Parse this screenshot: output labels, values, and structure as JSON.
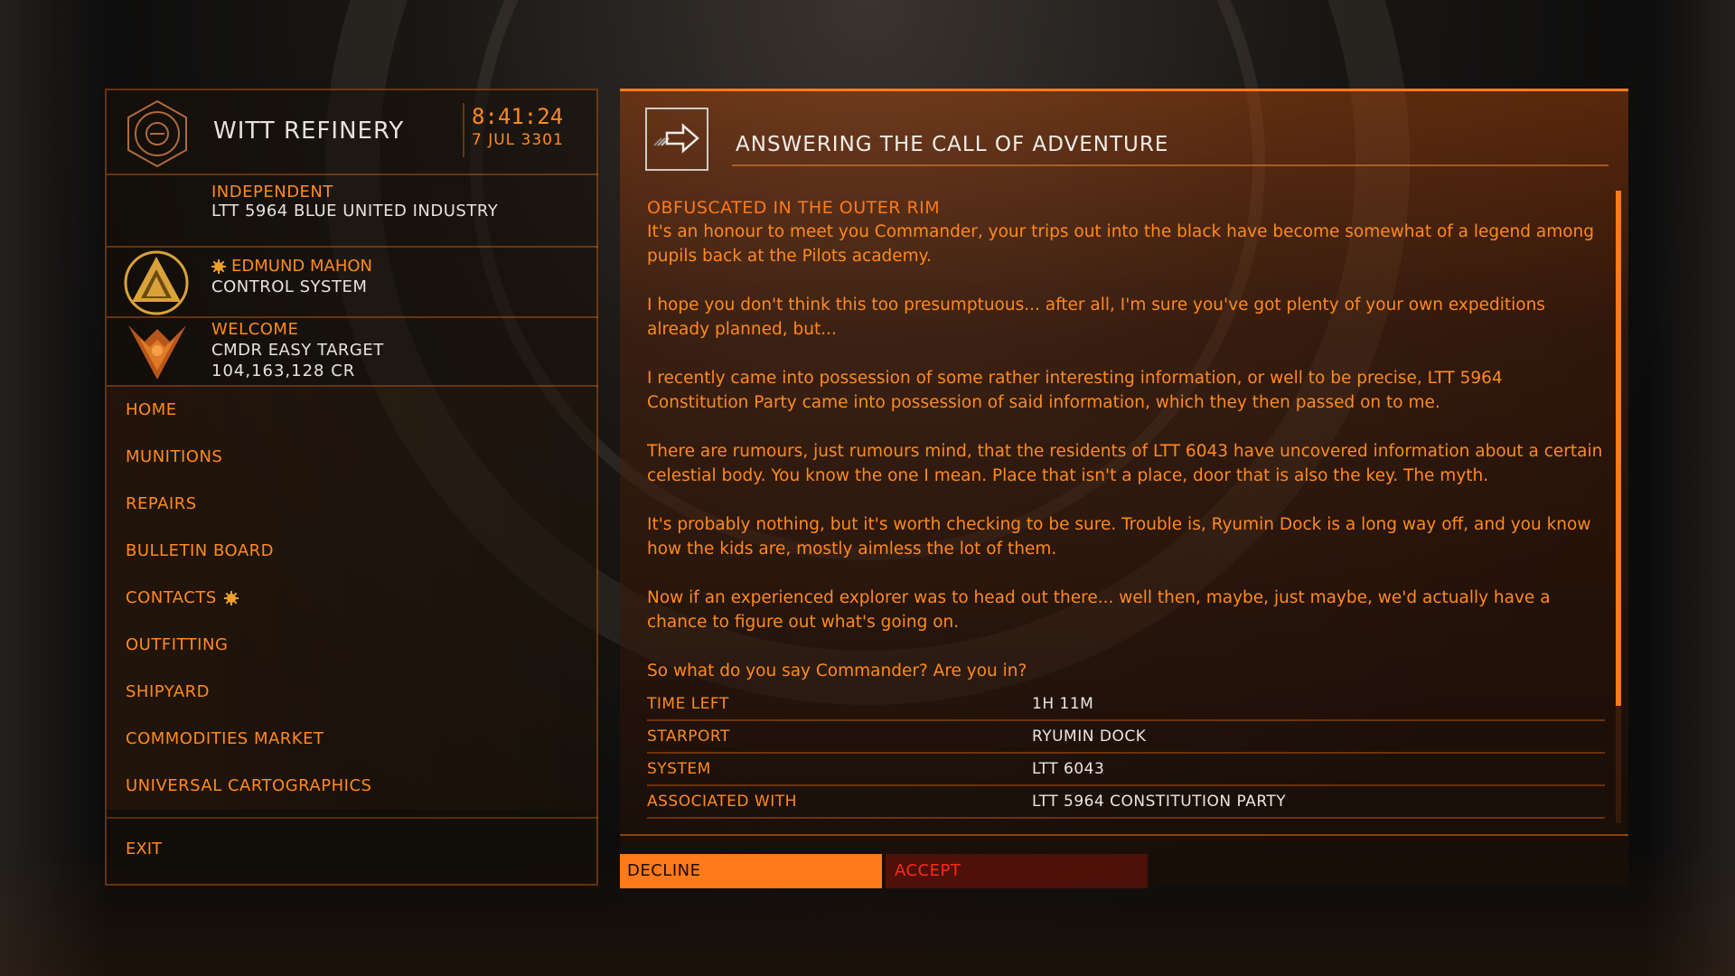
{
  "station": {
    "name": "WITT REFINERY",
    "time": "8:41:24",
    "date": "7 JUL 3301",
    "allegiance": "INDEPENDENT",
    "faction": "LTT 5964 BLUE UNITED INDUSTRY"
  },
  "power": {
    "name": "EDMUND MAHON",
    "state": "CONTROL SYSTEM"
  },
  "commander": {
    "welcome": "WELCOME",
    "name": "CMDR EASY TARGET",
    "credits": "104,163,128 CR"
  },
  "menu": {
    "items": [
      {
        "label": "HOME"
      },
      {
        "label": "MUNITIONS"
      },
      {
        "label": "REPAIRS"
      },
      {
        "label": "BULLETIN BOARD"
      },
      {
        "label": "CONTACTS"
      },
      {
        "label": "OUTFITTING"
      },
      {
        "label": "SHIPYARD"
      },
      {
        "label": "COMMODITIES MARKET"
      },
      {
        "label": "UNIVERSAL CARTOGRAPHICS"
      }
    ],
    "exit": "EXIT"
  },
  "mission": {
    "title": "ANSWERING THE CALL OF ADVENTURE",
    "subtitle": "OBFUSCATED IN THE OUTER RIM",
    "paragraphs": [
      "It's an honour to meet you Commander, your trips out into the black have become somewhat of a legend among pupils back at the Pilots academy.",
      "I hope you don't think this too presumptuous... after all, I'm sure you've got plenty of your own expeditions already planned, but...",
      "I recently came into possession of some rather interesting information, or well to be precise, LTT 5964 Constitution Party came into possession of said information, which they then passed on to me.",
      "There are rumours, just rumours mind, that the residents of LTT 6043 have uncovered information about a certain celestial body. You know the one I mean. Place that isn't a place, door that is also the key. The myth.",
      "It's probably nothing, but it's worth checking to be sure. Trouble is, Ryumin Dock is a long way off, and you know how the kids are, mostly aimless the lot of them.",
      " Now if an experienced explorer was to head out there... well then, maybe, just maybe, we'd actually have a chance to figure out what's going on.",
      "So what do you say Commander? Are you in?"
    ],
    "details": [
      {
        "label": "TIME LEFT",
        "value": "1H 11M"
      },
      {
        "label": "STARPORT",
        "value": "RYUMIN DOCK"
      },
      {
        "label": "SYSTEM",
        "value": "LTT 6043"
      },
      {
        "label": "ASSOCIATED WITH",
        "value": "LTT 5964 CONSTITUTION PARTY"
      }
    ],
    "decline": "DECLINE",
    "accept": "ACCEPT"
  },
  "icons": {
    "station": "station-emblem-icon",
    "power": "power-emblem-icon",
    "rank": "rank-wings-icon",
    "gear": "gear-icon",
    "mission": "arrow-right-icon"
  },
  "colors": {
    "accent": "#ff7a1a",
    "text_white": "#e8e2dc",
    "accept_red": "#ff2a14"
  }
}
